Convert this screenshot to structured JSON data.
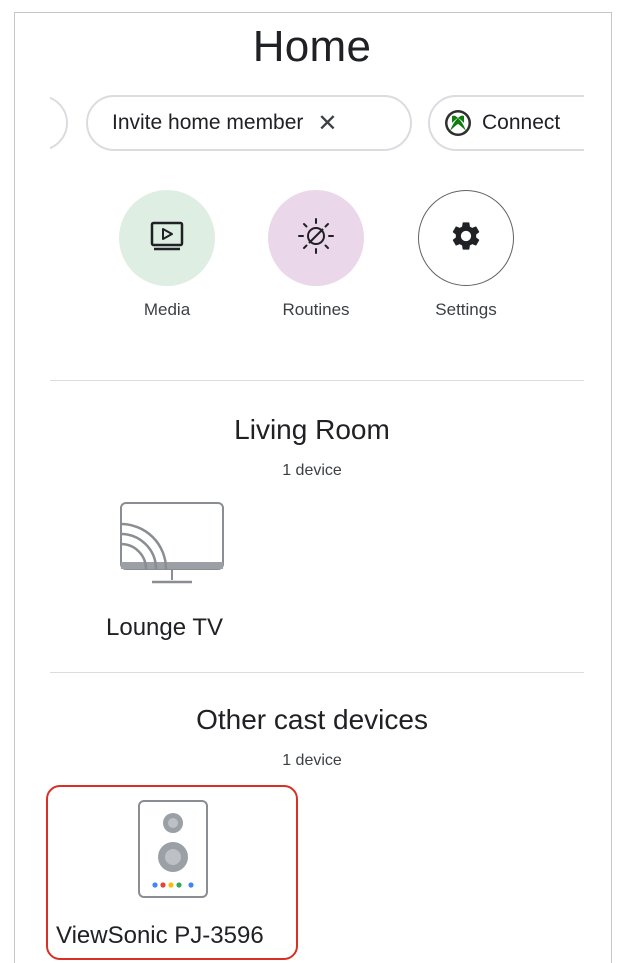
{
  "header": {
    "title": "Home"
  },
  "chips": {
    "invite_label": "Invite home member",
    "invite_close": "✕",
    "connect_label": "Connect"
  },
  "actions": [
    {
      "label": "Media",
      "icon": "play-box-icon",
      "bg": "#dfeee3"
    },
    {
      "label": "Routines",
      "icon": "sun-routine-icon",
      "bg": "#ead8ea"
    },
    {
      "label": "Settings",
      "icon": "gear-icon",
      "bg": "#ffffff"
    }
  ],
  "rooms": [
    {
      "title": "Living Room",
      "count": "1 device",
      "devices": [
        {
          "name": "Lounge TV",
          "icon": "cast-tv-icon"
        }
      ]
    },
    {
      "title": "Other cast devices",
      "count": "1 device",
      "devices": [
        {
          "name": "ViewSonic PJ-3596",
          "icon": "speaker-icon"
        }
      ]
    }
  ],
  "colors": {
    "highlight": "#d93025",
    "google_dots": [
      "#4285f4",
      "#ea4335",
      "#fbbc04",
      "#34a853"
    ]
  }
}
